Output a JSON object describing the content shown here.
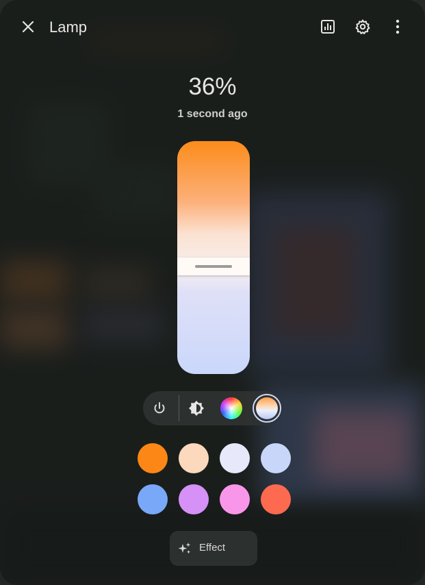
{
  "dialog": {
    "title": "Lamp",
    "close_icon": "close-icon",
    "history_icon": "history-chart-icon",
    "settings_icon": "gear-icon",
    "more_icon": "more-vert-icon"
  },
  "state": {
    "value": "36%",
    "last_changed": "1 second ago"
  },
  "slider": {
    "level_fraction": 0.36,
    "track_colors": [
      "#fc8c1b",
      "#fcb07a",
      "#fbe2d2",
      "#f6efef",
      "#dfe0f8",
      "#cad7fa"
    ]
  },
  "modes": [
    {
      "name": "power",
      "icon": "power-icon",
      "selected": false
    },
    {
      "name": "brightness",
      "icon": "brightness-icon",
      "selected": false
    },
    {
      "name": "color",
      "icon": "color-wheel-icon",
      "selected": false
    },
    {
      "name": "color-temperature",
      "icon": "color-temperature-icon",
      "selected": true
    }
  ],
  "favorite_colors": [
    "#fd8716",
    "#fcd8bc",
    "#e8e8fb",
    "#c8d6fa",
    "#79a8f8",
    "#d591f5",
    "#f897ea",
    "#fd6a50"
  ],
  "effect": {
    "label": "Effect",
    "icon": "sparkles-icon"
  }
}
